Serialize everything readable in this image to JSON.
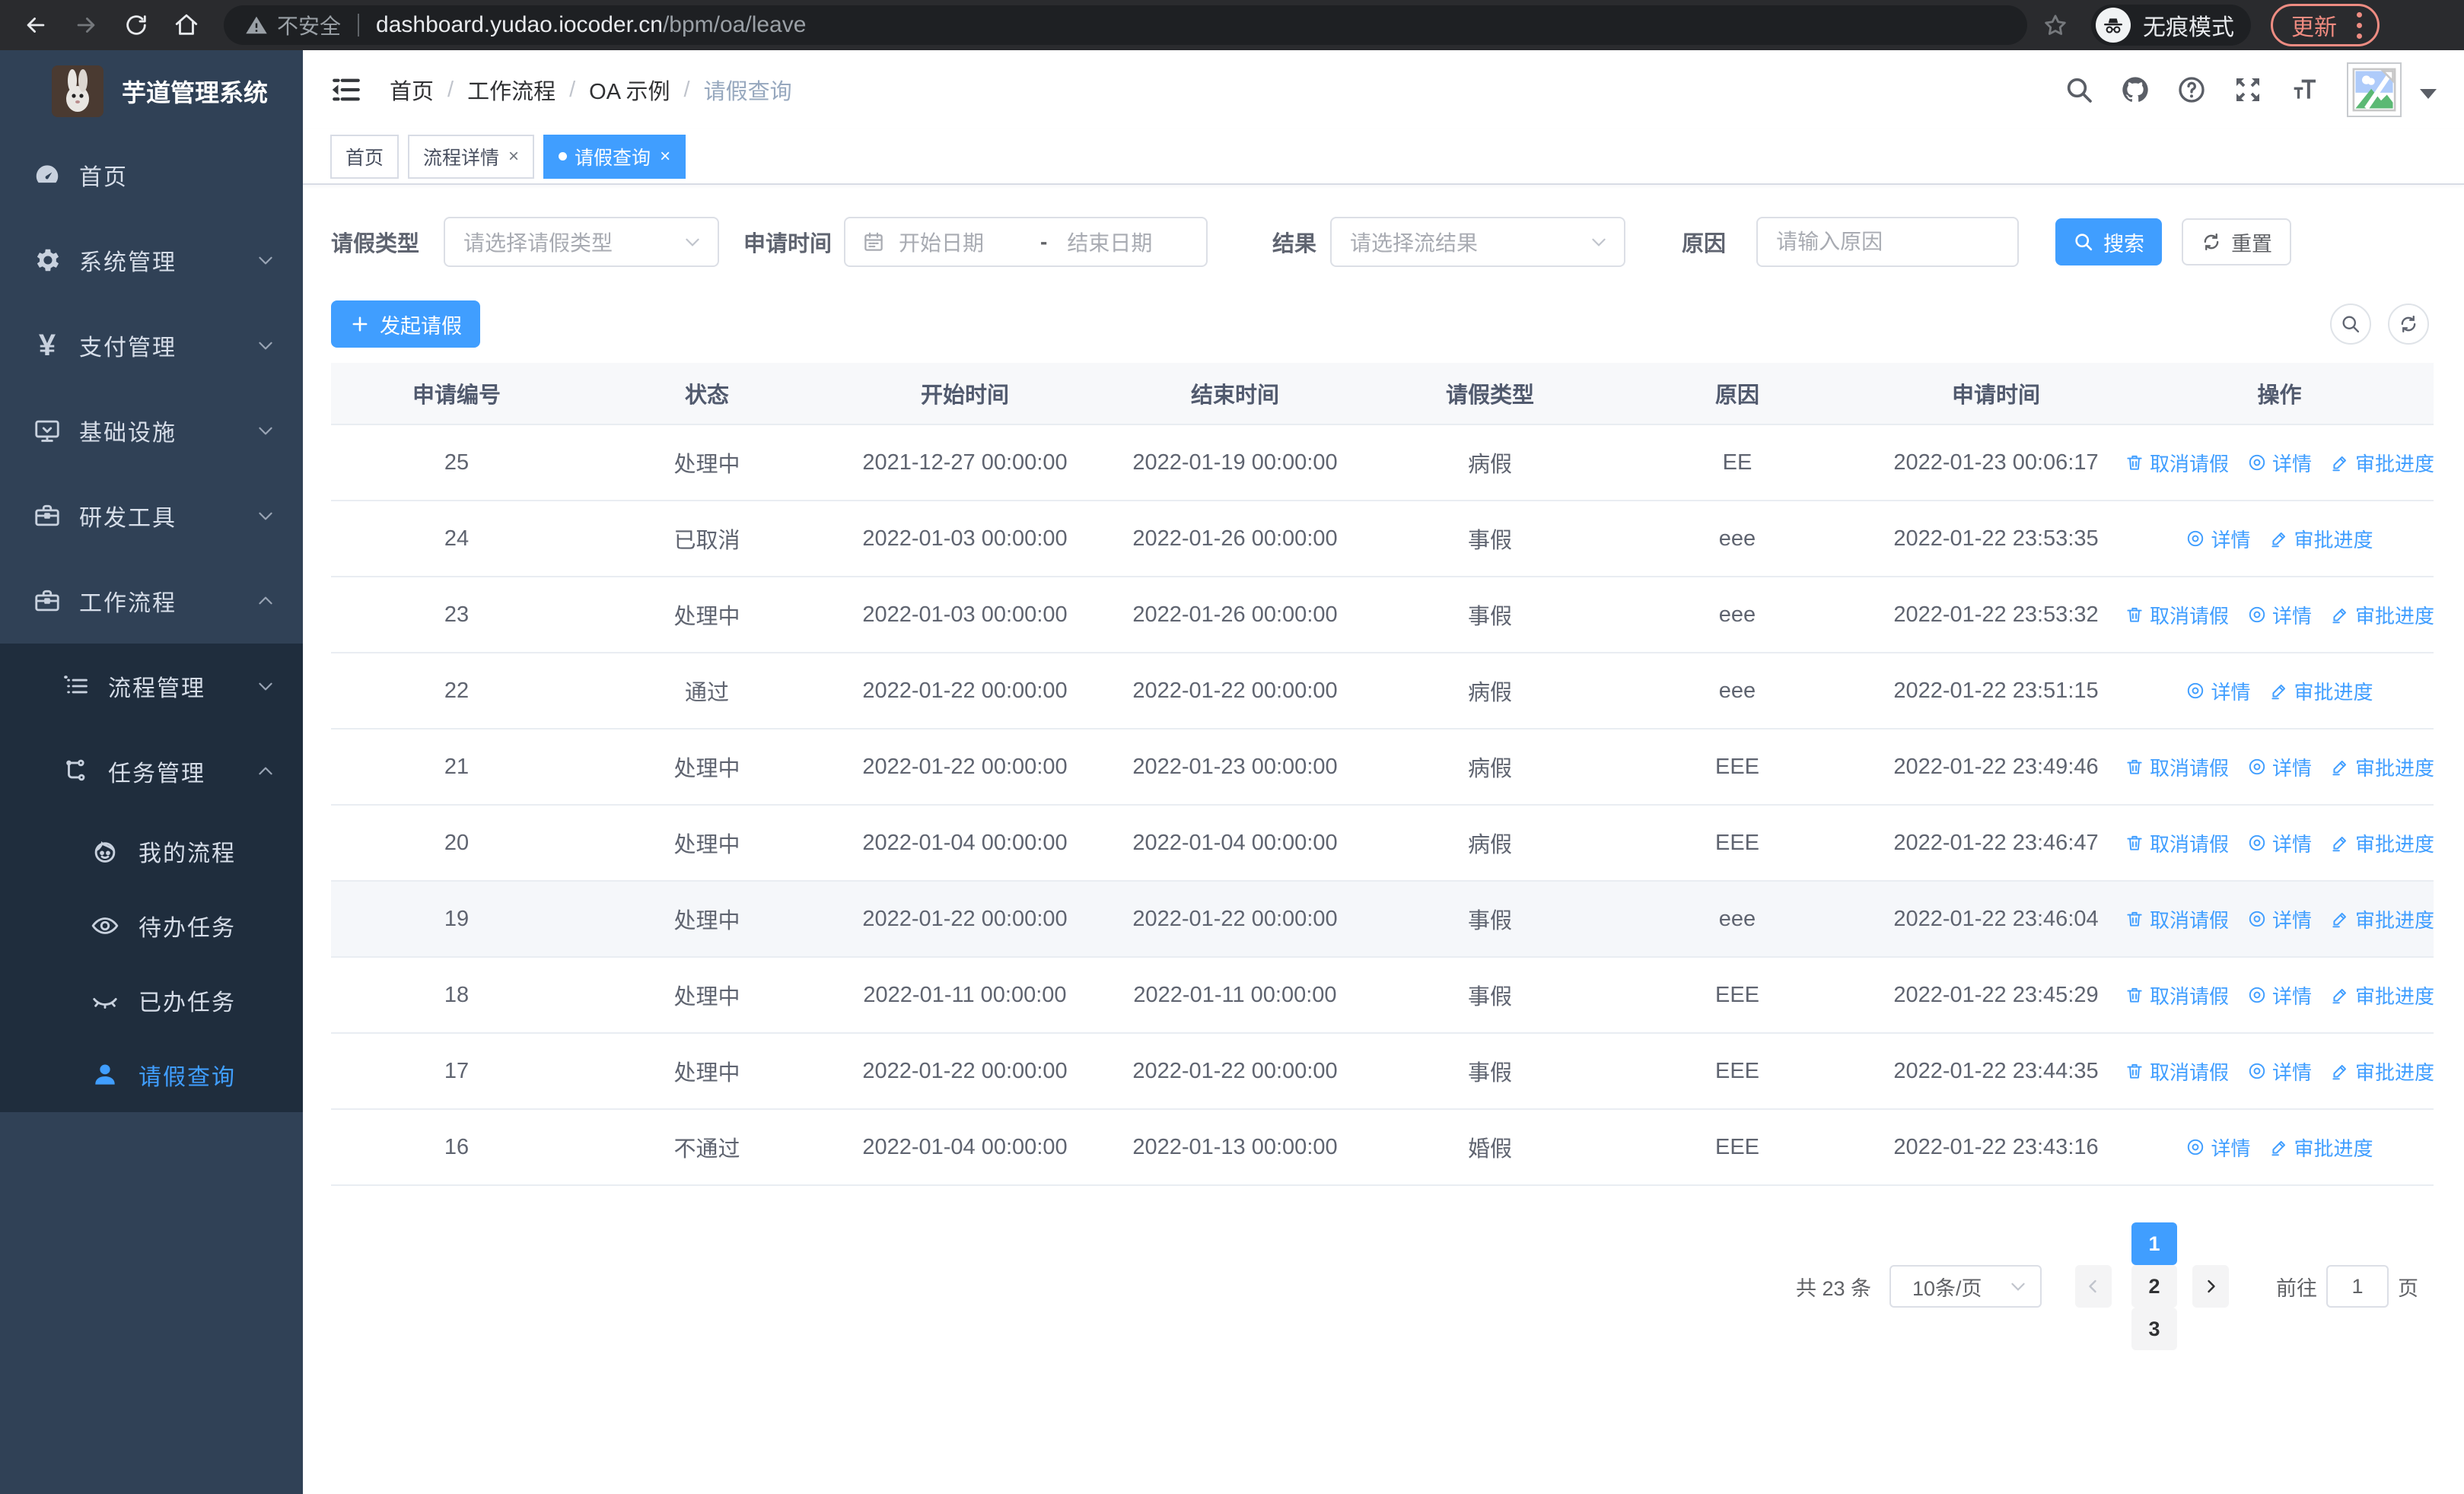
{
  "browser": {
    "security_warning": "不安全",
    "url_host": "dashboard.yudao.iocoder.cn",
    "url_path": "/bpm/oa/leave",
    "incognito_label": "无痕模式",
    "update_button": "更新"
  },
  "sidebar": {
    "title": "芋道管理系统",
    "items": [
      {
        "key": "home",
        "icon": "dashboard",
        "label": "首页",
        "level": 0,
        "chevron": null,
        "submenu": false,
        "active": false
      },
      {
        "key": "system",
        "icon": "gear",
        "label": "系统管理",
        "level": 0,
        "chevron": "down",
        "submenu": false,
        "active": false
      },
      {
        "key": "payment",
        "icon": "yen",
        "label": "支付管理",
        "level": 0,
        "chevron": "down",
        "submenu": false,
        "active": false
      },
      {
        "key": "infra",
        "icon": "monitor",
        "label": "基础设施",
        "level": 0,
        "chevron": "down",
        "submenu": false,
        "active": false
      },
      {
        "key": "devtools",
        "icon": "briefcase",
        "label": "研发工具",
        "level": 0,
        "chevron": "down",
        "submenu": false,
        "active": false
      },
      {
        "key": "workflow",
        "icon": "briefcase",
        "label": "工作流程",
        "level": 0,
        "chevron": "up",
        "submenu": false,
        "active": false
      },
      {
        "key": "process-mgmt",
        "icon": "list",
        "label": "流程管理",
        "level": 1,
        "chevron": "down",
        "submenu": true,
        "active": false
      },
      {
        "key": "task-mgmt",
        "icon": "tree",
        "label": "任务管理",
        "level": 1,
        "chevron": "up",
        "submenu": true,
        "active": false
      },
      {
        "key": "my-process",
        "icon": "face",
        "label": "我的流程",
        "level": 2,
        "chevron": null,
        "submenu": true,
        "active": false
      },
      {
        "key": "todo-tasks",
        "icon": "eye-open",
        "label": "待办任务",
        "level": 2,
        "chevron": null,
        "submenu": true,
        "active": false
      },
      {
        "key": "done-tasks",
        "icon": "eye-closed",
        "label": "已办任务",
        "level": 2,
        "chevron": null,
        "submenu": true,
        "active": false
      },
      {
        "key": "leave-query",
        "icon": "user",
        "label": "请假查询",
        "level": 2,
        "chevron": null,
        "submenu": true,
        "active": true
      }
    ]
  },
  "header": {
    "breadcrumb": [
      "首页",
      "工作流程",
      "OA 示例",
      "请假查询"
    ]
  },
  "tabs": [
    {
      "key": "home",
      "label": "首页",
      "closable": false,
      "active": false
    },
    {
      "key": "process-detail",
      "label": "流程详情",
      "closable": true,
      "active": false
    },
    {
      "key": "leave-query",
      "label": "请假查询",
      "closable": true,
      "active": true
    }
  ],
  "filters": {
    "leave_type_label": "请假类型",
    "leave_type_placeholder": "请选择请假类型",
    "apply_time_label": "申请时间",
    "start_date_placeholder": "开始日期",
    "range_separator": "-",
    "end_date_placeholder": "结束日期",
    "result_label": "结果",
    "result_placeholder": "请选择流结果",
    "reason_label": "原因",
    "reason_placeholder": "请输入原因",
    "search_button": "搜索",
    "reset_button": "重置"
  },
  "toolbar": {
    "create_button": "发起请假"
  },
  "table": {
    "columns": [
      "申请编号",
      "状态",
      "开始时间",
      "结束时间",
      "请假类型",
      "原因",
      "申请时间",
      "操作"
    ],
    "action_labels": {
      "cancel": "取消请假",
      "detail": "详情",
      "progress": "审批进度"
    },
    "rows": [
      {
        "id": "25",
        "status": "处理中",
        "start": "2021-12-27 00:00:00",
        "end": "2022-01-19 00:00:00",
        "type": "病假",
        "reason": "EE",
        "applied": "2022-01-23 00:06:17",
        "actions": [
          "cancel",
          "detail",
          "progress"
        ],
        "highlight": false
      },
      {
        "id": "24",
        "status": "已取消",
        "start": "2022-01-03 00:00:00",
        "end": "2022-01-26 00:00:00",
        "type": "事假",
        "reason": "eee",
        "applied": "2022-01-22 23:53:35",
        "actions": [
          "detail",
          "progress"
        ],
        "highlight": false
      },
      {
        "id": "23",
        "status": "处理中",
        "start": "2022-01-03 00:00:00",
        "end": "2022-01-26 00:00:00",
        "type": "事假",
        "reason": "eee",
        "applied": "2022-01-22 23:53:32",
        "actions": [
          "cancel",
          "detail",
          "progress"
        ],
        "highlight": false
      },
      {
        "id": "22",
        "status": "通过",
        "start": "2022-01-22 00:00:00",
        "end": "2022-01-22 00:00:00",
        "type": "病假",
        "reason": "eee",
        "applied": "2022-01-22 23:51:15",
        "actions": [
          "detail",
          "progress"
        ],
        "highlight": false
      },
      {
        "id": "21",
        "status": "处理中",
        "start": "2022-01-22 00:00:00",
        "end": "2022-01-23 00:00:00",
        "type": "病假",
        "reason": "EEE",
        "applied": "2022-01-22 23:49:46",
        "actions": [
          "cancel",
          "detail",
          "progress"
        ],
        "highlight": false
      },
      {
        "id": "20",
        "status": "处理中",
        "start": "2022-01-04 00:00:00",
        "end": "2022-01-04 00:00:00",
        "type": "病假",
        "reason": "EEE",
        "applied": "2022-01-22 23:46:47",
        "actions": [
          "cancel",
          "detail",
          "progress"
        ],
        "highlight": false
      },
      {
        "id": "19",
        "status": "处理中",
        "start": "2022-01-22 00:00:00",
        "end": "2022-01-22 00:00:00",
        "type": "事假",
        "reason": "eee",
        "applied": "2022-01-22 23:46:04",
        "actions": [
          "cancel",
          "detail",
          "progress"
        ],
        "highlight": true
      },
      {
        "id": "18",
        "status": "处理中",
        "start": "2022-01-11 00:00:00",
        "end": "2022-01-11 00:00:00",
        "type": "事假",
        "reason": "EEE",
        "applied": "2022-01-22 23:45:29",
        "actions": [
          "cancel",
          "detail",
          "progress"
        ],
        "highlight": false
      },
      {
        "id": "17",
        "status": "处理中",
        "start": "2022-01-22 00:00:00",
        "end": "2022-01-22 00:00:00",
        "type": "事假",
        "reason": "EEE",
        "applied": "2022-01-22 23:44:35",
        "actions": [
          "cancel",
          "detail",
          "progress"
        ],
        "highlight": false
      },
      {
        "id": "16",
        "status": "不通过",
        "start": "2022-01-04 00:00:00",
        "end": "2022-01-13 00:00:00",
        "type": "婚假",
        "reason": "EEE",
        "applied": "2022-01-22 23:43:16",
        "actions": [
          "detail",
          "progress"
        ],
        "highlight": false
      }
    ]
  },
  "pagination": {
    "total_text": "共 23 条",
    "page_size": "10条/页",
    "pages": [
      "1",
      "2",
      "3"
    ],
    "active_page": "1",
    "goto_label": "前往",
    "goto_value": "1",
    "page_suffix": "页"
  },
  "colors": {
    "accent": "#409EFF",
    "sidebar_bg": "#304156",
    "submenu_bg": "#1f2d3d",
    "chrome_bg": "#2a2b2e",
    "omnibox_bg": "#1e2023",
    "update_accent": "#ee8c82",
    "table_header_bg": "#f7f8fa",
    "row_highlight_bg": "#f5f7fa",
    "border": "#dcdfe6"
  }
}
